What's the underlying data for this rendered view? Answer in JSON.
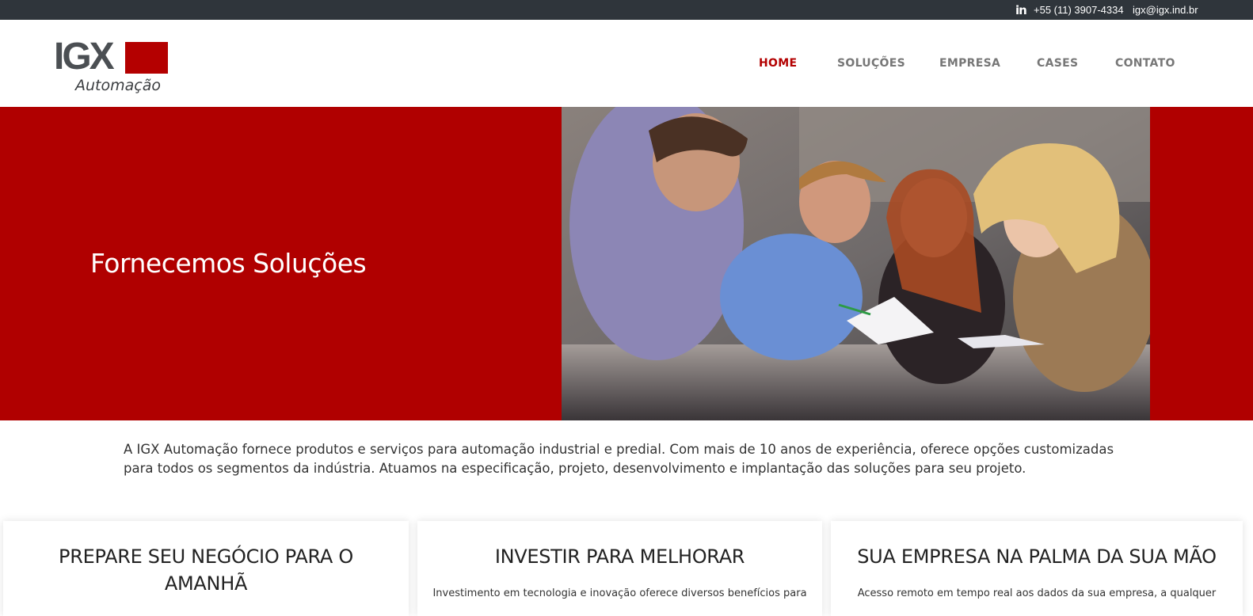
{
  "topbar": {
    "linkedin_icon": "linkedin-icon",
    "linkedin_text": "in",
    "phone": "+55 (11) 3907-4334",
    "email": "igx@igx.ind.br"
  },
  "logo": {
    "main": "IGX",
    "sub": "Automação"
  },
  "nav": {
    "items": [
      {
        "label": "HOME",
        "active": true
      },
      {
        "label": "SOLUÇÕES",
        "active": false
      },
      {
        "label": "EMPRESA",
        "active": false
      },
      {
        "label": "CASES",
        "active": false
      },
      {
        "label": "CONTATO",
        "active": false
      }
    ]
  },
  "hero": {
    "title": "Fornecemos Soluções",
    "background_color": "#b00000"
  },
  "intro": {
    "text": "A IGX Automação fornece produtos e serviços para automação industrial e predial. Com mais de 10 anos de experiência, oferece opções customizadas para todos os segmentos da indústria. Atuamos na especificação, projeto, desenvolvimento e implantação das soluções para seu projeto."
  },
  "cards": [
    {
      "title": "PREPARE SEU NEGÓCIO PARA O AMANHÃ",
      "text": ""
    },
    {
      "title": "INVESTIR PARA MELHORAR",
      "text": "Investimento em tecnologia e inovação oferece diversos benefícios para"
    },
    {
      "title": "SUA EMPRESA NA PALMA DA SUA MÃO",
      "text": "Acesso remoto em tempo real aos dados da sua empresa, a qualquer"
    }
  ],
  "colors": {
    "brand_red": "#b00000",
    "topbar_dark": "#2f353b",
    "logo_gray": "#4b4f53"
  }
}
